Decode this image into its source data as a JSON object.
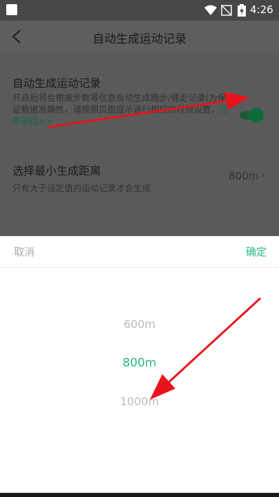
{
  "status_bar": {
    "time": "4:26"
  },
  "header": {
    "title": "自动生成运动记录"
  },
  "settings": {
    "auto_record": {
      "name": "自动生成运动记录",
      "desc": "开启后将会根据步数等信息自动生成跑步/健走记录(为保证数据准确性，请按照页面提示进行相应的权限设置，",
      "link": "立即前往>>",
      "enabled": true
    },
    "min_distance": {
      "name": "选择最小生成距离",
      "desc": "只有大于设定值的运动记录才会生成",
      "value": "800m"
    }
  },
  "sheet": {
    "cancel": "取消",
    "confirm": "确定",
    "options": [
      "600m",
      "800m",
      "1000m"
    ],
    "selected": "800m"
  },
  "colors": {
    "accent": "#2bb97c",
    "annotation": "#e8141b"
  }
}
